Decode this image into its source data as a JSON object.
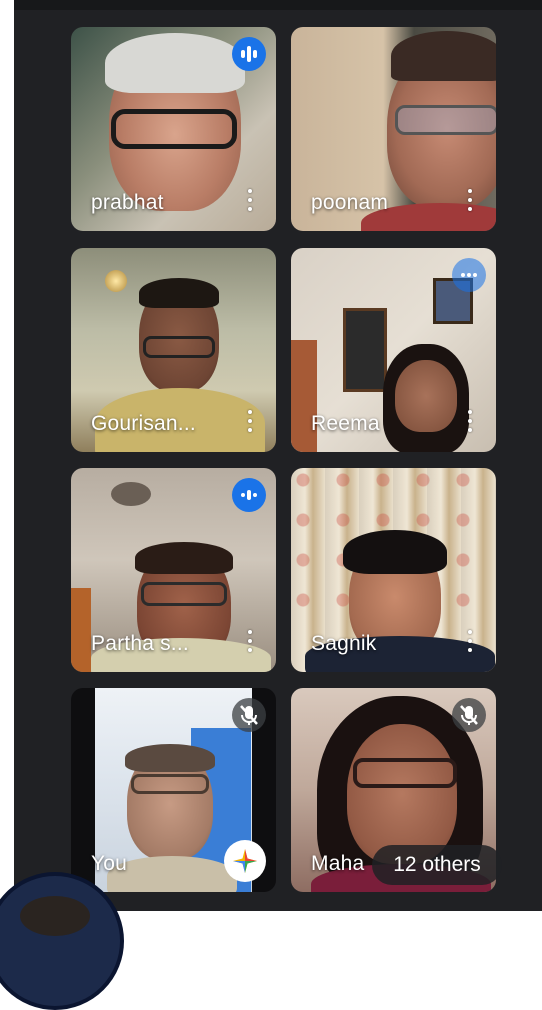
{
  "participants": [
    {
      "name": "prabhat",
      "status": "speaking"
    },
    {
      "name": "poonam",
      "status": "none"
    },
    {
      "name": "Gourisan...",
      "status": "none"
    },
    {
      "name": "Reema",
      "status": "none"
    },
    {
      "name": "Partha s...",
      "status": "speaking"
    },
    {
      "name": "Sagnik",
      "status": "none"
    },
    {
      "name": "You",
      "status": "muted"
    },
    {
      "name": "Maha",
      "status": "muted"
    }
  ],
  "others_label": "12 others",
  "colors": {
    "background": "#202124",
    "speaking_indicator": "#1a73e8",
    "text": "#ffffff"
  }
}
